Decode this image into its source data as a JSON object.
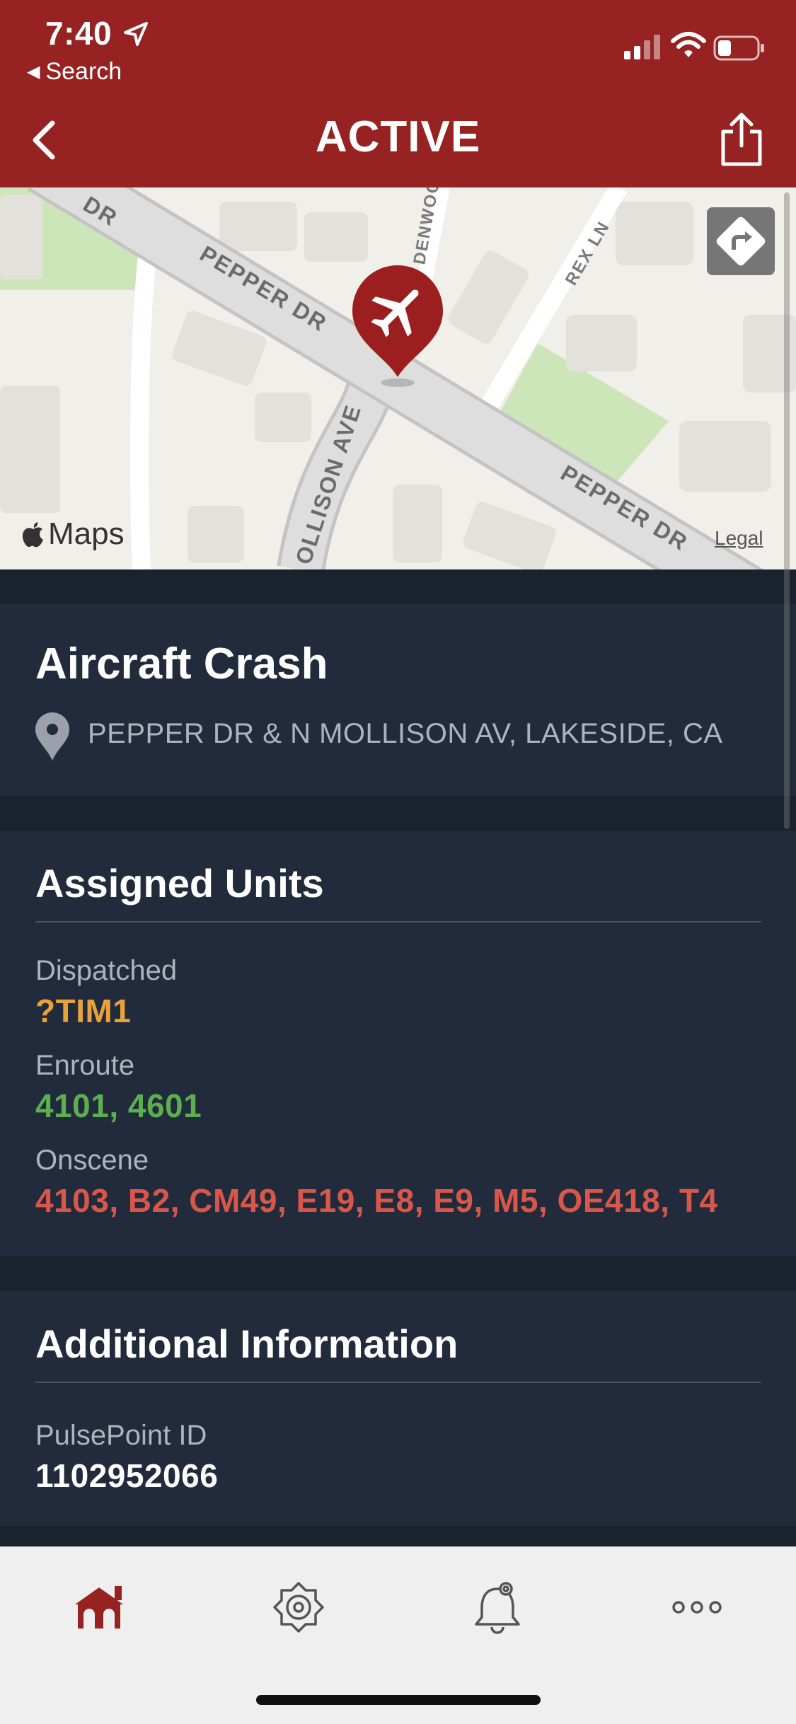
{
  "status_bar": {
    "time": "7:40",
    "back_label": "Search",
    "icons": [
      "location-arrow-icon",
      "cellular-signal-icon",
      "wifi-icon",
      "battery-icon"
    ]
  },
  "nav": {
    "title": "ACTIVE",
    "icons": [
      "chevron-left-icon",
      "share-icon"
    ]
  },
  "map": {
    "street_labels": [
      "DR",
      "PEPPER DR",
      "DENWOO",
      "REX LN",
      "OLLISON AVE",
      "PEPPER DR"
    ],
    "attribution": "Maps",
    "legal": "Legal",
    "marker_icon": "airplane-icon",
    "directions_icon": "directions-icon"
  },
  "incident": {
    "title": "Aircraft Crash",
    "address": "PEPPER DR & N MOLLISON AV, LAKESIDE, CA"
  },
  "assigned_units": {
    "heading": "Assigned Units",
    "dispatched_label": "Dispatched",
    "dispatched_value": "?TIM1",
    "enroute_label": "Enroute",
    "enroute_value": "4101, 4601",
    "onscene_label": "Onscene",
    "onscene_value": "4103, B2, CM49, E19, E8, E9, M5, OE418, T4"
  },
  "additional_info": {
    "heading": "Additional Information",
    "id_label": "PulsePoint ID",
    "id_value": "1102952066"
  },
  "tabbar": {
    "tabs": [
      "home-icon",
      "fire-badge-icon",
      "alert-settings-icon",
      "more-icon"
    ],
    "active_tab": "home-icon"
  },
  "colors": {
    "brand": "#962222",
    "dispatched": "#e8a23a",
    "enroute": "#5cae4f",
    "onscene": "#d8574a",
    "panel": "#212b3b",
    "background": "#19222d"
  }
}
